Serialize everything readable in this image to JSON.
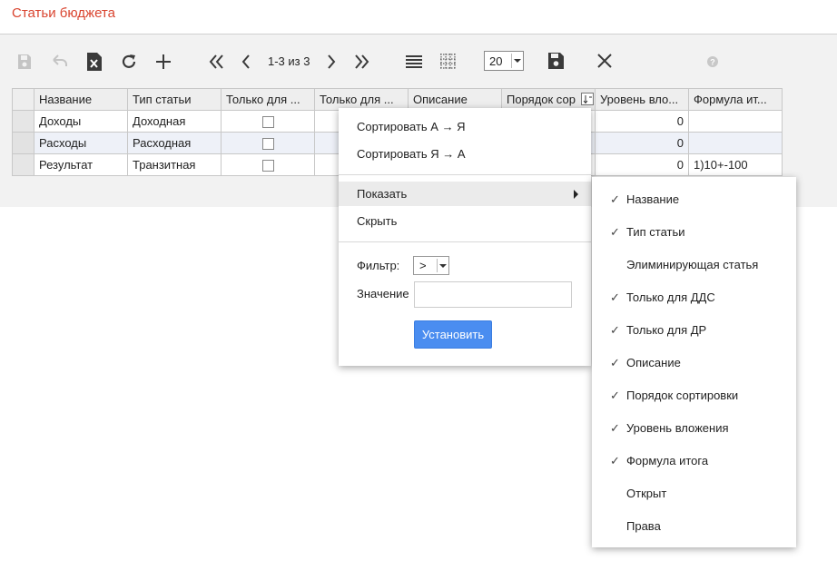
{
  "page": {
    "title": "Статьи бюджета"
  },
  "toolbar": {
    "pager_text": "1-3 из 3",
    "page_size": "20",
    "icons": [
      "save-icon",
      "undo-icon",
      "export-excel-icon",
      "refresh-icon",
      "add-icon",
      "first-page-icon",
      "prev-page-icon",
      "next-page-icon",
      "last-page-icon",
      "rows-view-icon",
      "grid-view-icon",
      "save-settings-icon",
      "close-icon",
      "help-icon"
    ]
  },
  "grid": {
    "columns": [
      "Название",
      "Тип статьи",
      "Только для ...",
      "Только для ...",
      "Описание",
      "Порядок сор",
      "Уровень вло...",
      "Формула ит..."
    ],
    "rows": [
      {
        "name": "Доходы",
        "type": "Доходная",
        "level": "0",
        "formula": ""
      },
      {
        "name": "Расходы",
        "type": "Расходная",
        "level": "0",
        "formula": ""
      },
      {
        "name": "Результат",
        "type": "Транзитная",
        "level": "0",
        "formula": "1)10+-100"
      }
    ]
  },
  "column_menu": {
    "sort_asc": "Сортировать А → Я",
    "sort_desc": "Сортировать Я → А",
    "show": "Показать",
    "hide": "Скрыть",
    "filter_label": "Фильтр:",
    "filter_value": ">",
    "value_label": "Значение",
    "value_input": "",
    "apply_button": "Установить"
  },
  "columns_submenu": {
    "items": [
      {
        "label": "Название",
        "checked": true,
        "check": "✓"
      },
      {
        "label": "Тип статьи",
        "checked": true,
        "check": "✓"
      },
      {
        "label": "Элиминирующая статья",
        "checked": false,
        "check": ""
      },
      {
        "label": "Только для ДДС",
        "checked": true,
        "check": "✓"
      },
      {
        "label": "Только для ДР",
        "checked": true,
        "check": "✓"
      },
      {
        "label": "Описание",
        "checked": true,
        "check": "✓"
      },
      {
        "label": "Порядок сортировки",
        "checked": true,
        "check": "✓"
      },
      {
        "label": "Уровень вложения",
        "checked": true,
        "check": "✓"
      },
      {
        "label": "Формула итога",
        "checked": true,
        "check": "✓"
      },
      {
        "label": "Открыт",
        "checked": false,
        "check": ""
      },
      {
        "label": "Права",
        "checked": false,
        "check": ""
      }
    ]
  },
  "colors": {
    "title": "#d9442f",
    "accent": "#4a8df0",
    "alt_row": "#eef1f8"
  }
}
